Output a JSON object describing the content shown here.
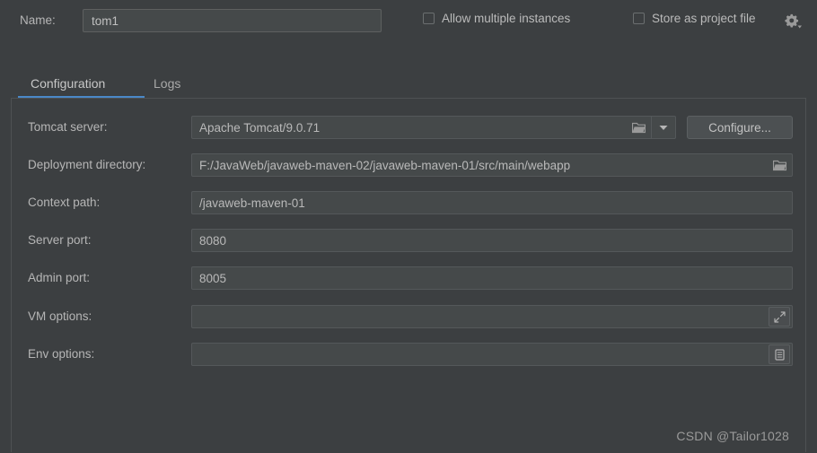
{
  "window": {
    "background_color": "#3c3f41",
    "accent_color": "#4a88c7"
  },
  "header": {
    "name_label": "Name:",
    "name_value": "tom1",
    "name_placeholder": "Name",
    "checkboxes": [
      {
        "label": "Allow multiple instances",
        "checked": false
      },
      {
        "label": "Store as project file",
        "checked": false
      }
    ],
    "gear_icon": "gear-icon"
  },
  "tabs": [
    {
      "label": "Configuration",
      "active": true
    },
    {
      "label": "Logs",
      "active": false
    }
  ],
  "form": {
    "rows": [
      {
        "label": "Tomcat server:",
        "value": "Apache Tomcat/9.0.71",
        "type": "combo",
        "icons": [
          "folder-icon",
          "chevron-down-icon"
        ]
      },
      {
        "label": "Deployment directory:",
        "value": "F:/JavaWeb/javaweb-maven-02/javaweb-maven-01/src/main/webapp",
        "type": "text-with-browse",
        "icons": [
          "folder-icon"
        ]
      },
      {
        "label": "Context path:",
        "value": "/javaweb-maven-01",
        "type": "text",
        "icons": []
      },
      {
        "label": "Server port:",
        "value": "8080",
        "type": "text",
        "icons": []
      },
      {
        "label": "Admin port:",
        "value": "8005",
        "type": "text",
        "icons": []
      },
      {
        "label": "VM options:",
        "value": "",
        "type": "text-with-expand",
        "icons": [
          "expand-icon"
        ]
      },
      {
        "label": "Env options:",
        "value": "",
        "type": "text-with-list",
        "icons": [
          "list-icon"
        ]
      }
    ],
    "configure_button": "Configure..."
  },
  "watermark": "CSDN @Tailor1028"
}
